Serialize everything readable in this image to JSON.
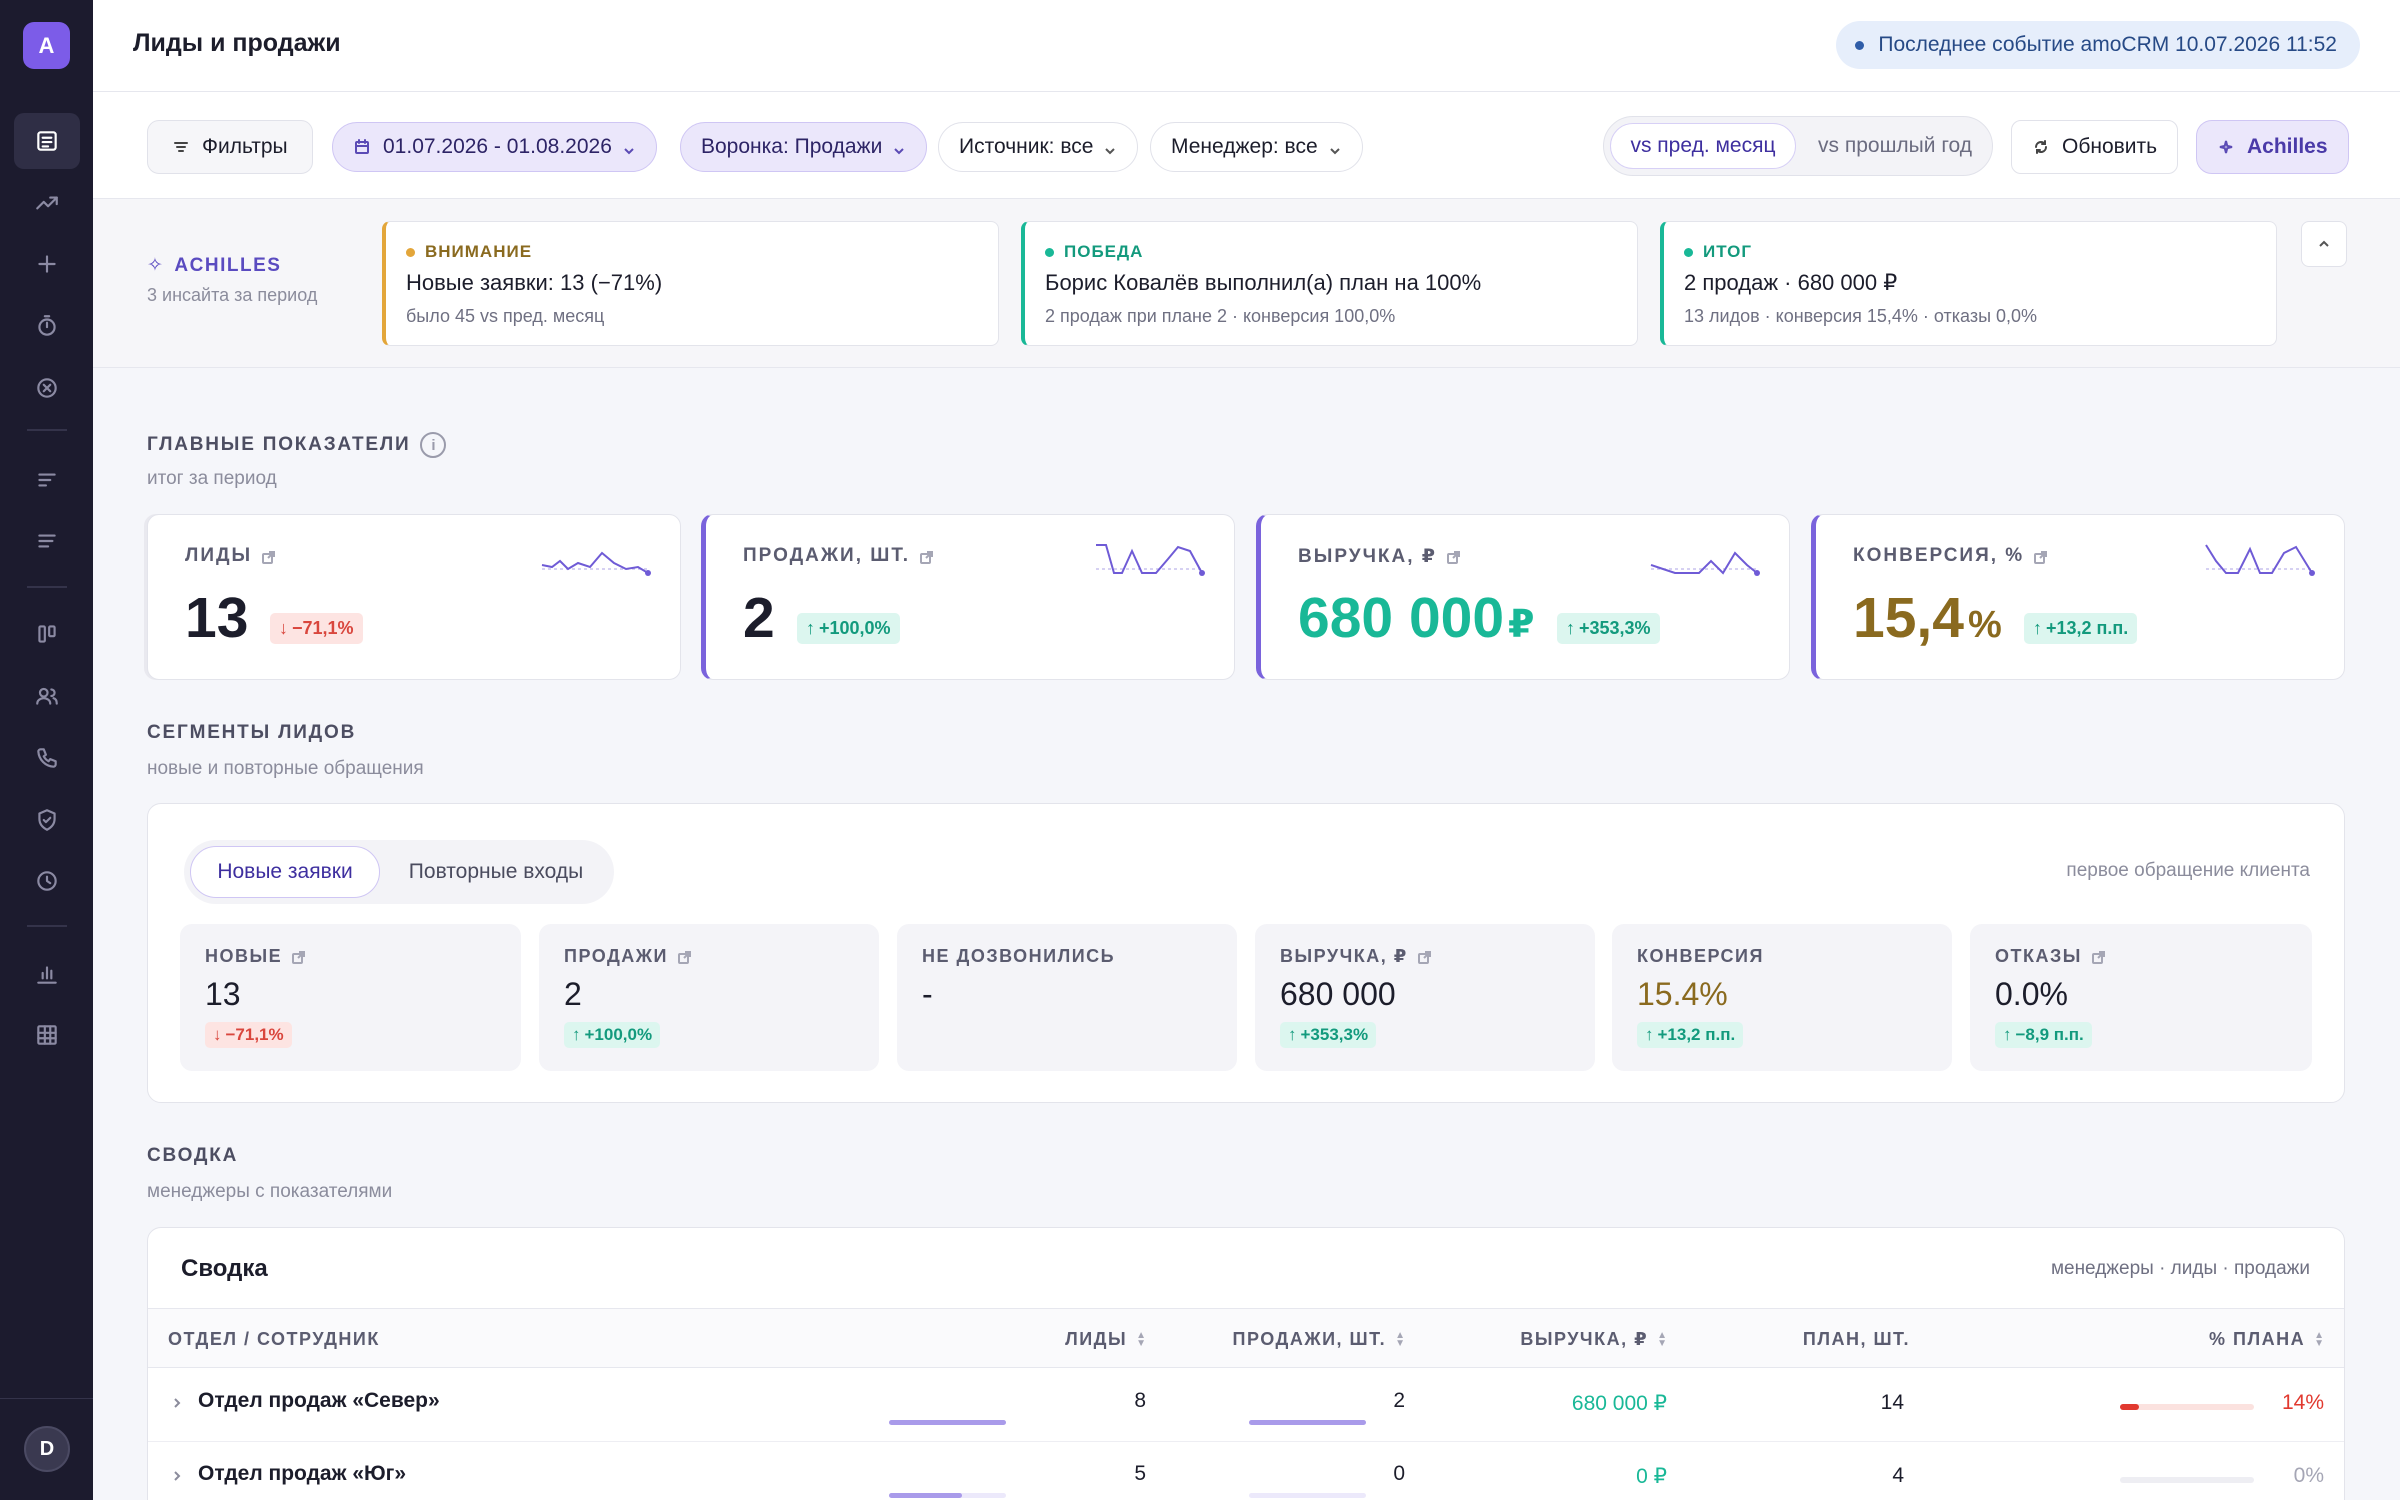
{
  "app": {
    "logo_letter": "A",
    "user_initial": "D"
  },
  "header": {
    "title": "Лиды и продажи",
    "last_event": "Последнее событие amoCRM 10.07.2026 11:52"
  },
  "sidebar": {
    "icons": [
      "report-icon",
      "trend-icon",
      "plus-icon",
      "timer-icon",
      "cancel-circle-icon",
      "bars-icon",
      "bars-alt-icon",
      "kanban-icon",
      "users-icon",
      "phone-icon",
      "shield-icon",
      "clock-icon",
      "chart-icon",
      "grid-icon"
    ]
  },
  "filters": {
    "filters_label": "Фильтры",
    "date_range": "01.07.2026 - 01.08.2026",
    "funnel": "Воронка: Продажи",
    "source": "Источник: все",
    "manager": "Менеджер: все",
    "compare_prev_month": "vs пред. месяц",
    "compare_prev_year": "vs прошлый год",
    "refresh_label": "Обновить",
    "achilles_label": "Achilles"
  },
  "insights": {
    "label": "ACHILLES",
    "subtitle": "3 инсайта за период",
    "cards": [
      {
        "tag": "ВНИМАНИЕ",
        "color": "#e3a63a",
        "title": "Новые заявки: 13 (−71%)",
        "detail": "было 45 vs пред. месяц"
      },
      {
        "tag": "ПОБЕДА",
        "color": "#19b897",
        "title": "Борис Ковалёв выполнил(а) план на 100%",
        "detail": "2 продаж при плане 2 · конверсия 100,0%"
      },
      {
        "tag": "ИТОГ",
        "color": "#19b897",
        "title": "2 продаж · 680 000 ₽",
        "detail": "13 лидов · конверсия 15,4% · отказы 0,0%"
      }
    ]
  },
  "kpi_section": {
    "title": "ГЛАВНЫЕ ПОКАЗАТЕЛИ",
    "subtitle": "итог за период"
  },
  "kpis": [
    {
      "label": "ЛИДЫ",
      "value": "13",
      "unit": "",
      "delta": "−71,1%",
      "trend": "down",
      "value_color": "#1c1d2b"
    },
    {
      "label": "ПРОДАЖИ, ШТ.",
      "value": "2",
      "unit": "",
      "delta": "+100,0%",
      "trend": "up",
      "value_color": "#1c1d2b"
    },
    {
      "label": "ВЫРУЧКА, ₽",
      "value": "680 000",
      "unit": "₽",
      "delta": "+353,3%",
      "trend": "up",
      "value_color": "#19b897"
    },
    {
      "label": "КОНВЕРСИЯ, %",
      "value": "15,4",
      "unit": "%",
      "delta": "+13,2 п.п.",
      "trend": "up",
      "value_color": "#8a6a1f"
    }
  ],
  "segments_section": {
    "title": "СЕГМЕНТЫ ЛИДОВ",
    "subtitle": "новые и повторные обращения"
  },
  "segments": {
    "tab_new": "Новые заявки",
    "tab_repeat": "Повторные входы",
    "note": "первое обращение клиента",
    "cards": [
      {
        "label": "НОВЫЕ",
        "value": "13",
        "delta": "−71,1%",
        "trend": "down",
        "value_color": "#1c1d2b"
      },
      {
        "label": "ПРОДАЖИ",
        "value": "2",
        "delta": "+100,0%",
        "trend": "up",
        "value_color": "#1c1d2b"
      },
      {
        "label": "НЕ ДОЗВОНИЛИСЬ",
        "value": "-",
        "delta": "",
        "trend": "none",
        "value_color": "#1c1d2b"
      },
      {
        "label": "ВЫРУЧКА, ₽",
        "value": "680 000",
        "delta": "+353,3%",
        "trend": "up",
        "value_color": "#1c1d2b"
      },
      {
        "label": "КОНВЕРСИЯ",
        "value": "15.4%",
        "delta": "+13,2 п.п.",
        "trend": "up",
        "value_color": "#8a6a1f"
      },
      {
        "label": "ОТКАЗЫ",
        "value": "0.0%",
        "delta": "−8,9 п.п.",
        "trend": "up",
        "value_color": "#1c1d2b"
      }
    ]
  },
  "summary_section": {
    "title": "СВОДКА",
    "subtitle": "менеджеры с показателями"
  },
  "summary": {
    "title": "Сводка",
    "note": "менеджеры · лиды · продажи",
    "columns": [
      "ОТДЕЛ / СОТРУДНИК",
      "ЛИДЫ",
      "ПРОДАЖИ, ШТ.",
      "ВЫРУЧКА, ₽",
      "ПЛАН, ШТ.",
      "% ПЛАНА"
    ],
    "rows": [
      {
        "name": "Отдел продаж «Север»",
        "leads": "8",
        "sales": "2",
        "revenue": "680 000 ₽",
        "plan": "14",
        "plan_pct": "14%",
        "plan_fraction": 0.14,
        "leads_share": 1.0,
        "sales_share": 1.0
      },
      {
        "name": "Отдел продаж «Юг»",
        "leads": "5",
        "sales": "0",
        "revenue": "0 ₽",
        "plan": "4",
        "plan_pct": "0%",
        "plan_fraction": 0.0,
        "leads_share": 0.62,
        "sales_share": 0.0
      }
    ]
  }
}
